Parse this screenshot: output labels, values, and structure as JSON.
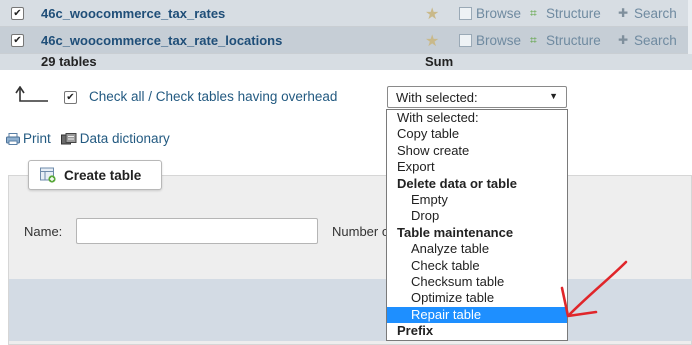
{
  "tables": [
    {
      "name": "46c_woocommerce_tax_rates",
      "checked": true
    },
    {
      "name": "46c_woocommerce_tax_rate_locations",
      "checked": true
    }
  ],
  "actions": {
    "browse": "Browse",
    "structure": "Structure",
    "search": "Search"
  },
  "summary": {
    "count": "29 tables",
    "sum": "Sum"
  },
  "bulk": {
    "check_all_label": "Check all / Check tables having overhead",
    "select_value": "With selected:"
  },
  "links": {
    "print": "Print",
    "data_dictionary": "Data dictionary"
  },
  "create": {
    "tab_label": "Create table",
    "name_label": "Name:",
    "name_value": "",
    "number_label": "Number o"
  },
  "dropdown": {
    "options": [
      {
        "label": "With selected:",
        "kind": "opt"
      },
      {
        "label": "Copy table",
        "kind": "opt"
      },
      {
        "label": "Show create",
        "kind": "opt"
      },
      {
        "label": "Export",
        "kind": "opt"
      },
      {
        "label": "Delete data or table",
        "kind": "grp"
      },
      {
        "label": "Empty",
        "kind": "sub"
      },
      {
        "label": "Drop",
        "kind": "sub"
      },
      {
        "label": "Table maintenance",
        "kind": "grp"
      },
      {
        "label": "Analyze table",
        "kind": "sub"
      },
      {
        "label": "Check table",
        "kind": "sub"
      },
      {
        "label": "Checksum table",
        "kind": "sub"
      },
      {
        "label": "Optimize table",
        "kind": "sub"
      },
      {
        "label": "Repair table",
        "kind": "sub",
        "selected": true
      },
      {
        "label": "Prefix",
        "kind": "grp"
      }
    ]
  },
  "colors": {
    "highlight": "#1e8fff",
    "annotation_arrow": "#e0262a",
    "link": "#235a81"
  },
  "icons": [
    "checkbox-icon",
    "star-icon",
    "browse-icon",
    "structure-icon",
    "search-icon",
    "arrow-up-left-icon",
    "print-icon",
    "data-dictionary-icon",
    "create-table-icon",
    "red-annotation-arrow"
  ]
}
